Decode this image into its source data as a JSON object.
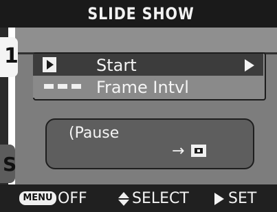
{
  "header": {
    "title": "SLIDE SHOW"
  },
  "tabs": [
    {
      "label": "1"
    },
    {
      "label": "S"
    }
  ],
  "menu": {
    "items": [
      {
        "label": "Start",
        "icon": "play-icon",
        "selected": true
      },
      {
        "label": "Frame Intvl",
        "icon": "interval-dots-icon",
        "selected": false
      }
    ]
  },
  "help": {
    "pause_text": "(Pause",
    "arrow_text": "→",
    "icon": "ok-button-icon"
  },
  "footer": {
    "menu_badge": "MENU",
    "off_label": "OFF",
    "select_label": "SELECT",
    "set_label": "SET"
  },
  "colors": {
    "background": "#7d7d7d",
    "selected_row": "#3c3c3c",
    "bars": "#1a1a1a",
    "text": "#f4f4f4"
  }
}
